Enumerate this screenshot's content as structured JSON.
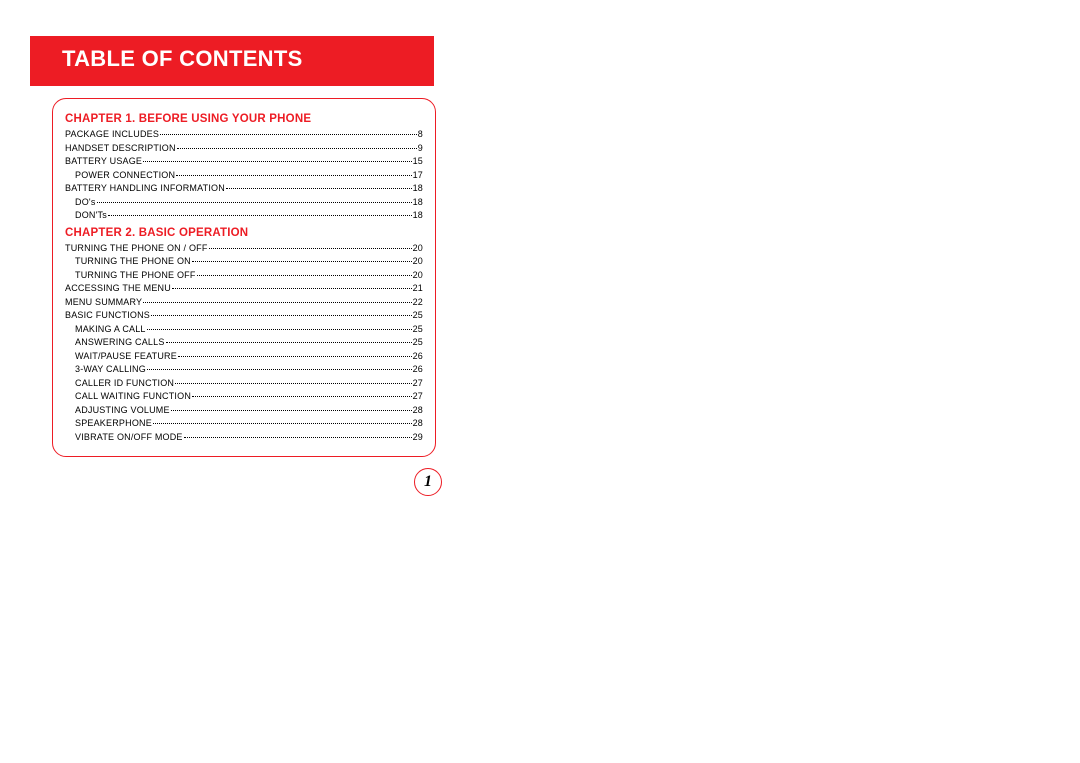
{
  "title": "TABLE OF CONTENTS",
  "page_number": "1",
  "chapters": [
    {
      "heading": "CHAPTER 1.  BEFORE USING YOUR PHONE",
      "entries": [
        {
          "label": "PACKAGE INCLUDES",
          "page": "8",
          "level": 0
        },
        {
          "label": "HANDSET DESCRIPTION",
          "page": "9",
          "level": 0
        },
        {
          "label": "BATTERY USAGE",
          "page": "15",
          "level": 0
        },
        {
          "label": "POWER CONNECTION",
          "page": "17",
          "level": 1
        },
        {
          "label": "BATTERY HANDLING INFORMATION",
          "page": "18",
          "level": 0
        },
        {
          "label": "DO's",
          "page": "18",
          "level": 1
        },
        {
          "label": "DON'Ts",
          "page": "18",
          "level": 1
        }
      ]
    },
    {
      "heading": "CHAPTER 2.  BASIC OPERATION",
      "entries": [
        {
          "label": "TURNING THE PHONE ON / OFF",
          "page": "20",
          "level": 0
        },
        {
          "label": "TURNING THE PHONE ON",
          "page": "20",
          "level": 1
        },
        {
          "label": "TURNING THE PHONE OFF",
          "page": "20",
          "level": 1
        },
        {
          "label": "ACCESSING THE MENU",
          "page": "21",
          "level": 0
        },
        {
          "label": "MENU SUMMARY",
          "page": "22",
          "level": 0
        },
        {
          "label": "BASIC FUNCTIONS",
          "page": "25",
          "level": 0
        },
        {
          "label": "MAKING A CALL",
          "page": "25",
          "level": 1
        },
        {
          "label": "ANSWERING CALLS",
          "page": "25",
          "level": 1
        },
        {
          "label": "WAIT/PAUSE FEATURE",
          "page": "26",
          "level": 1
        },
        {
          "label": "3-WAY CALLING",
          "page": "26",
          "level": 1
        },
        {
          "label": "CALLER ID FUNCTION",
          "page": "27",
          "level": 1
        },
        {
          "label": "CALL WAITING FUNCTION",
          "page": "27",
          "level": 1
        },
        {
          "label": "ADJUSTING VOLUME",
          "page": "28",
          "level": 1
        },
        {
          "label": "SPEAKERPHONE",
          "page": "28",
          "level": 1
        },
        {
          "label": "VIBRATE ON/OFF MODE",
          "page": "29",
          "level": 1
        }
      ]
    }
  ]
}
